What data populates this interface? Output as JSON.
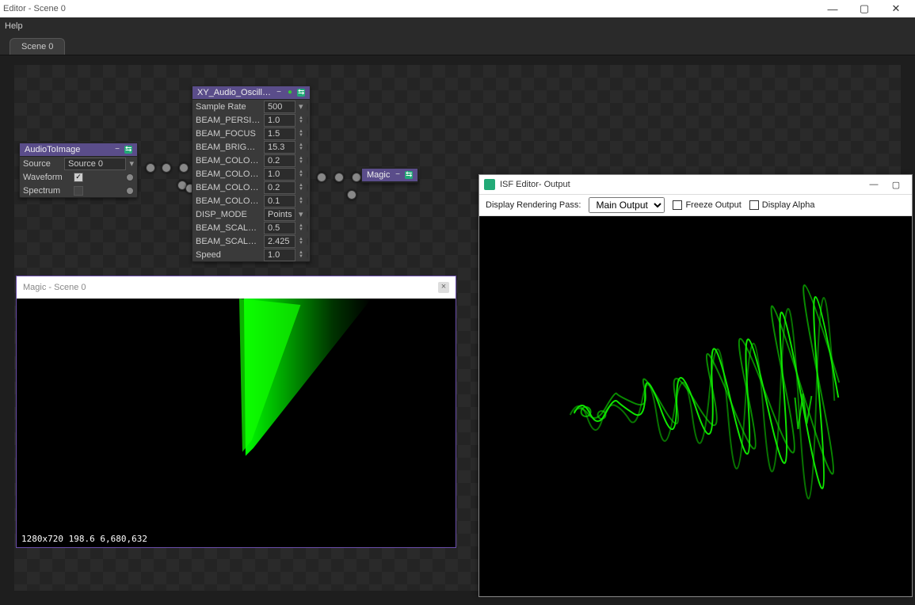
{
  "window_title": "Editor - Scene 0",
  "menu": {
    "help": "Help"
  },
  "tab": "Scene 0",
  "nodes": {
    "audio_to_image": {
      "title": "AudioToImage",
      "source_label": "Source",
      "source_value": "Source 0",
      "waveform_label": "Waveform",
      "waveform_checked": true,
      "spectrum_label": "Spectrum",
      "spectrum_checked": false
    },
    "oscilloscope": {
      "title": "XY_Audio_Oscilloscope...",
      "params": [
        {
          "label": "Sample Rate",
          "value": "500",
          "dropdown": true
        },
        {
          "label": "BEAM_PERSIST...",
          "value": "1.0"
        },
        {
          "label": "BEAM_FOCUS",
          "value": "1.5"
        },
        {
          "label": "BEAM_BRIGHT...",
          "value": "15.3"
        },
        {
          "label": "BEAM_COLOR R",
          "value": "0.2"
        },
        {
          "label": "BEAM_COLOR G",
          "value": "1.0"
        },
        {
          "label": "BEAM_COLOR B",
          "value": "0.2"
        },
        {
          "label": "BEAM_COLOR A",
          "value": "0.1"
        },
        {
          "label": "DISP_MODE",
          "value": "Points",
          "dropdown": true
        },
        {
          "label": "BEAM_SCALE_X",
          "value": "0.5"
        },
        {
          "label": "BEAM_SCALE_Y",
          "value": "2.425"
        },
        {
          "label": "Speed",
          "value": "1.0"
        }
      ]
    },
    "magic": {
      "title": "Magic"
    }
  },
  "preview": {
    "title": "Magic - Scene 0",
    "status": "1280x720   198.6  6,680,632"
  },
  "output_window": {
    "title": "ISF Editor- Output",
    "pass_label": "Display Rendering Pass:",
    "pass_value": "Main Output",
    "freeze_label": "Freeze Output",
    "alpha_label": "Display Alpha"
  }
}
